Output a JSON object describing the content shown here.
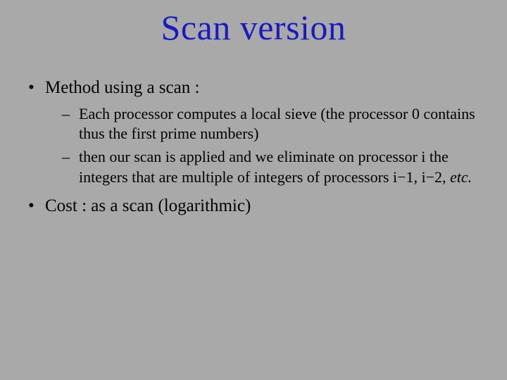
{
  "title": "Scan version",
  "bullets": [
    {
      "text": "Method using a scan :",
      "sub": [
        "Each processor computes a local sieve (the processor 0 contains thus the first prime numbers)",
        "then our scan is applied and we eliminate on processor i the integers that are multiple of integers of processors i−1, i−2, "
      ],
      "sub_tail_italic": "etc."
    },
    {
      "text": "Cost : as a scan (logarithmic)"
    }
  ]
}
